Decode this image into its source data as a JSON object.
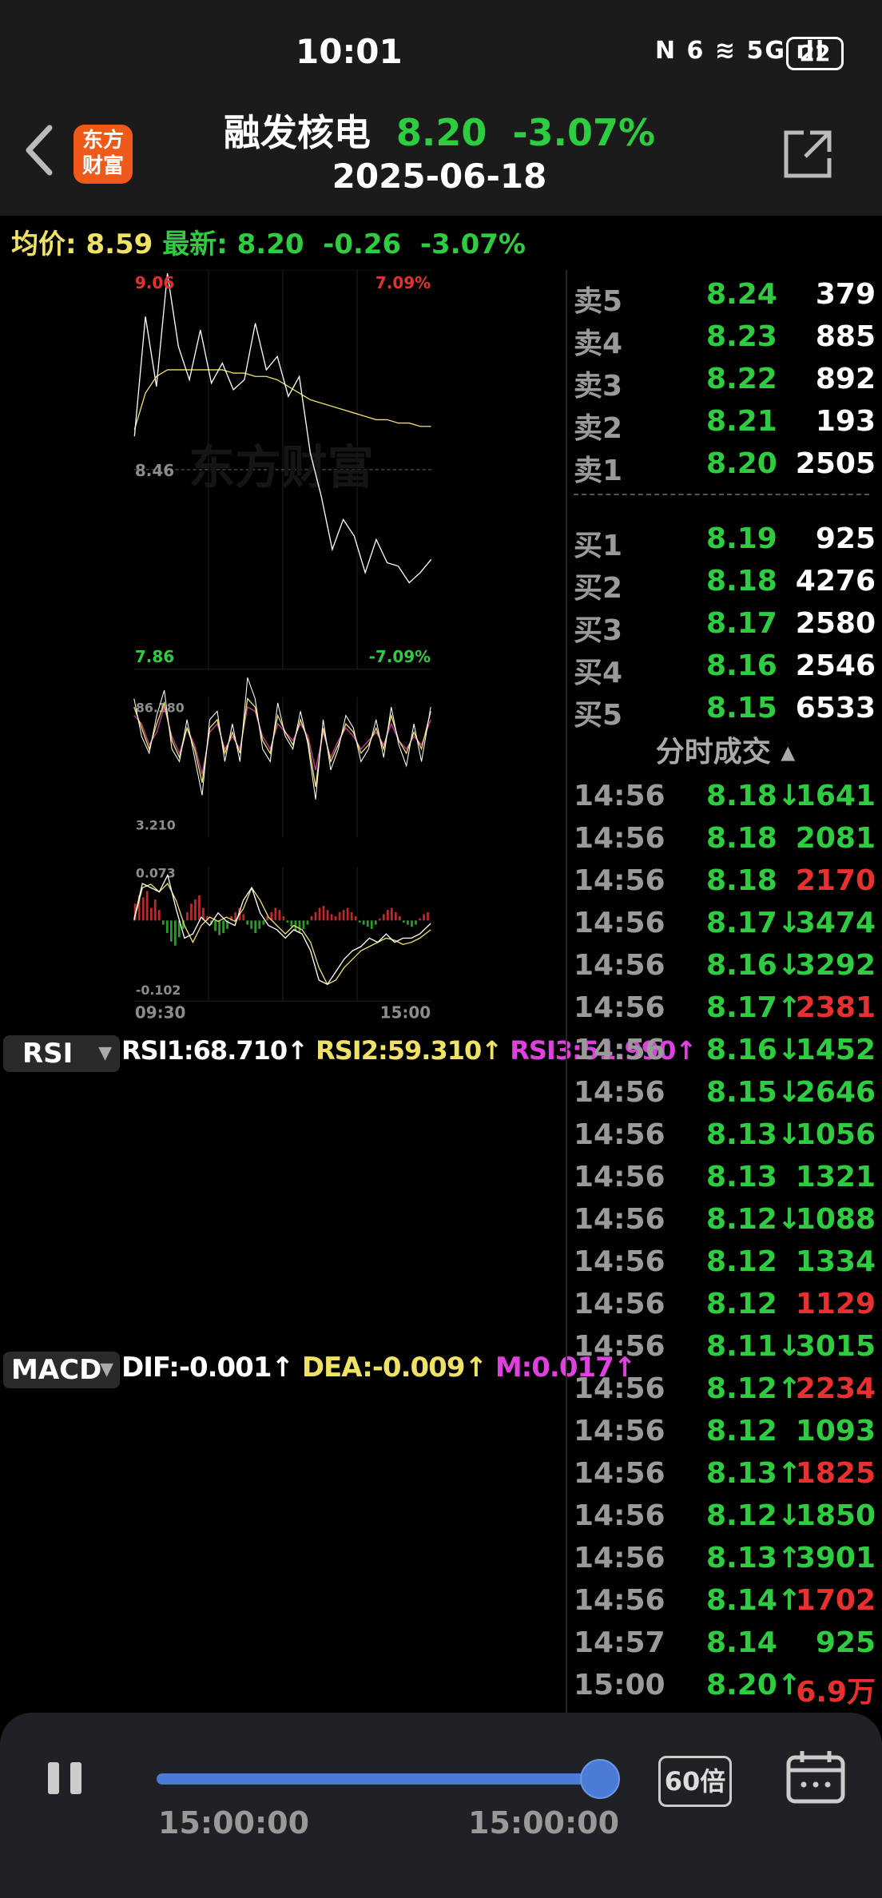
{
  "status_bar": {
    "time": "10:01",
    "icons": "N 6 ≋ 5G ıll",
    "battery": "22"
  },
  "header": {
    "logo_line1": "东方",
    "logo_line2": "财富",
    "stock_name": "融发核电",
    "price": "8.20",
    "change_pct": "-3.07%",
    "date": "2025-06-18"
  },
  "info": {
    "avg_label": "均价:",
    "avg_value": "8.59",
    "latest_label": "最新:",
    "latest_value": "8.20",
    "change": "-0.26",
    "change_pct": "-3.07%"
  },
  "price_chart": {
    "high_price": "9.06",
    "high_pct": "7.09%",
    "mid_price": "8.46",
    "low_price": "7.86",
    "low_pct": "-7.09%",
    "watermark": "东方财富",
    "time_start": "09:30",
    "time_end": "15:00",
    "colors": {
      "price_line": "#ffffff",
      "avg_line": "#f0e264",
      "up": "#e83030",
      "down": "#2ecc40"
    }
  },
  "chart_data": {
    "type": "line",
    "title": "",
    "xlabel": "",
    "ylabel": "",
    "x": [
      "09:30",
      "15:00"
    ],
    "ylim": [
      7.86,
      9.06
    ],
    "series": [
      {
        "name": "",
        "values": [
          8.56,
          8.92,
          8.71,
          9.05,
          8.83,
          8.73,
          8.88,
          8.72,
          8.78,
          8.7,
          8.73,
          8.9,
          8.76,
          8.8,
          8.68,
          8.74,
          8.51,
          8.38,
          8.22,
          8.31,
          8.26,
          8.15,
          8.25,
          8.18,
          8.17,
          8.12,
          8.15,
          8.19
        ]
      },
      {
        "name": "",
        "values": [
          8.58,
          8.69,
          8.74,
          8.76,
          8.76,
          8.76,
          8.76,
          8.76,
          8.76,
          8.75,
          8.75,
          8.74,
          8.74,
          8.73,
          8.71,
          8.69,
          8.67,
          8.66,
          8.65,
          8.64,
          8.63,
          8.62,
          8.61,
          8.61,
          8.6,
          8.6,
          8.59,
          8.59
        ]
      }
    ]
  },
  "rsi": {
    "selector": "RSI",
    "rsi1": "RSI1:68.710↑",
    "rsi2": "RSI2:59.310↑",
    "rsi3": "RSI3:51.990↑",
    "top": "86.180",
    "bottom": "3.210"
  },
  "macd": {
    "selector": "MACD",
    "dif": "DIF:-0.001↑",
    "dea": "DEA:-0.009↑",
    "m": "M:0.017↑",
    "top": "0.073",
    "bottom": "-0.102"
  },
  "order_book": {
    "asks": [
      {
        "label": "卖5",
        "price": "8.24",
        "vol": "379"
      },
      {
        "label": "卖4",
        "price": "8.23",
        "vol": "885"
      },
      {
        "label": "卖3",
        "price": "8.22",
        "vol": "892"
      },
      {
        "label": "卖2",
        "price": "8.21",
        "vol": "193"
      },
      {
        "label": "卖1",
        "price": "8.20",
        "vol": "2505"
      }
    ],
    "bids": [
      {
        "label": "买1",
        "price": "8.19",
        "vol": "925"
      },
      {
        "label": "买2",
        "price": "8.18",
        "vol": "4276"
      },
      {
        "label": "买3",
        "price": "8.17",
        "vol": "2580"
      },
      {
        "label": "买4",
        "price": "8.16",
        "vol": "2546"
      },
      {
        "label": "买5",
        "price": "8.15",
        "vol": "6533"
      }
    ]
  },
  "trades_title": "分时成交 ▴",
  "trades": [
    {
      "time": "14:56",
      "price": "8.18↓",
      "vol": "1641",
      "dir": "down"
    },
    {
      "time": "14:56",
      "price": "8.18",
      "vol": "2081",
      "dir": "down"
    },
    {
      "time": "14:56",
      "price": "8.18",
      "vol": "2170",
      "dir": "up"
    },
    {
      "time": "14:56",
      "price": "8.17↓",
      "vol": "3474",
      "dir": "down"
    },
    {
      "time": "14:56",
      "price": "8.16↓",
      "vol": "3292",
      "dir": "down"
    },
    {
      "time": "14:56",
      "price": "8.17↑",
      "vol": "2381",
      "dir": "up"
    },
    {
      "time": "14:56",
      "price": "8.16↓",
      "vol": "1452",
      "dir": "down"
    },
    {
      "time": "14:56",
      "price": "8.15↓",
      "vol": "2646",
      "dir": "down"
    },
    {
      "time": "14:56",
      "price": "8.13↓",
      "vol": "1056",
      "dir": "down"
    },
    {
      "time": "14:56",
      "price": "8.13",
      "vol": "1321",
      "dir": "down"
    },
    {
      "time": "14:56",
      "price": "8.12↓",
      "vol": "1088",
      "dir": "down"
    },
    {
      "time": "14:56",
      "price": "8.12",
      "vol": "1334",
      "dir": "down"
    },
    {
      "time": "14:56",
      "price": "8.12",
      "vol": "1129",
      "dir": "up"
    },
    {
      "time": "14:56",
      "price": "8.11↓",
      "vol": "3015",
      "dir": "down"
    },
    {
      "time": "14:56",
      "price": "8.12↑",
      "vol": "2234",
      "dir": "up"
    },
    {
      "time": "14:56",
      "price": "8.12",
      "vol": "1093",
      "dir": "down"
    },
    {
      "time": "14:56",
      "price": "8.13↑",
      "vol": "1825",
      "dir": "up"
    },
    {
      "time": "14:56",
      "price": "8.12↓",
      "vol": "1850",
      "dir": "down"
    },
    {
      "time": "14:56",
      "price": "8.13↑",
      "vol": "3901",
      "dir": "down"
    },
    {
      "time": "14:56",
      "price": "8.14↑",
      "vol": "1702",
      "dir": "up"
    },
    {
      "time": "14:57",
      "price": "8.14",
      "vol": "925",
      "dir": "down"
    },
    {
      "time": "15:00",
      "price": "8.20↑",
      "vol": "6.9万",
      "dir": "up"
    }
  ],
  "playback": {
    "start_time": "15:00:00",
    "end_time": "15:00:00",
    "speed": "60倍",
    "progress": 1.0
  }
}
